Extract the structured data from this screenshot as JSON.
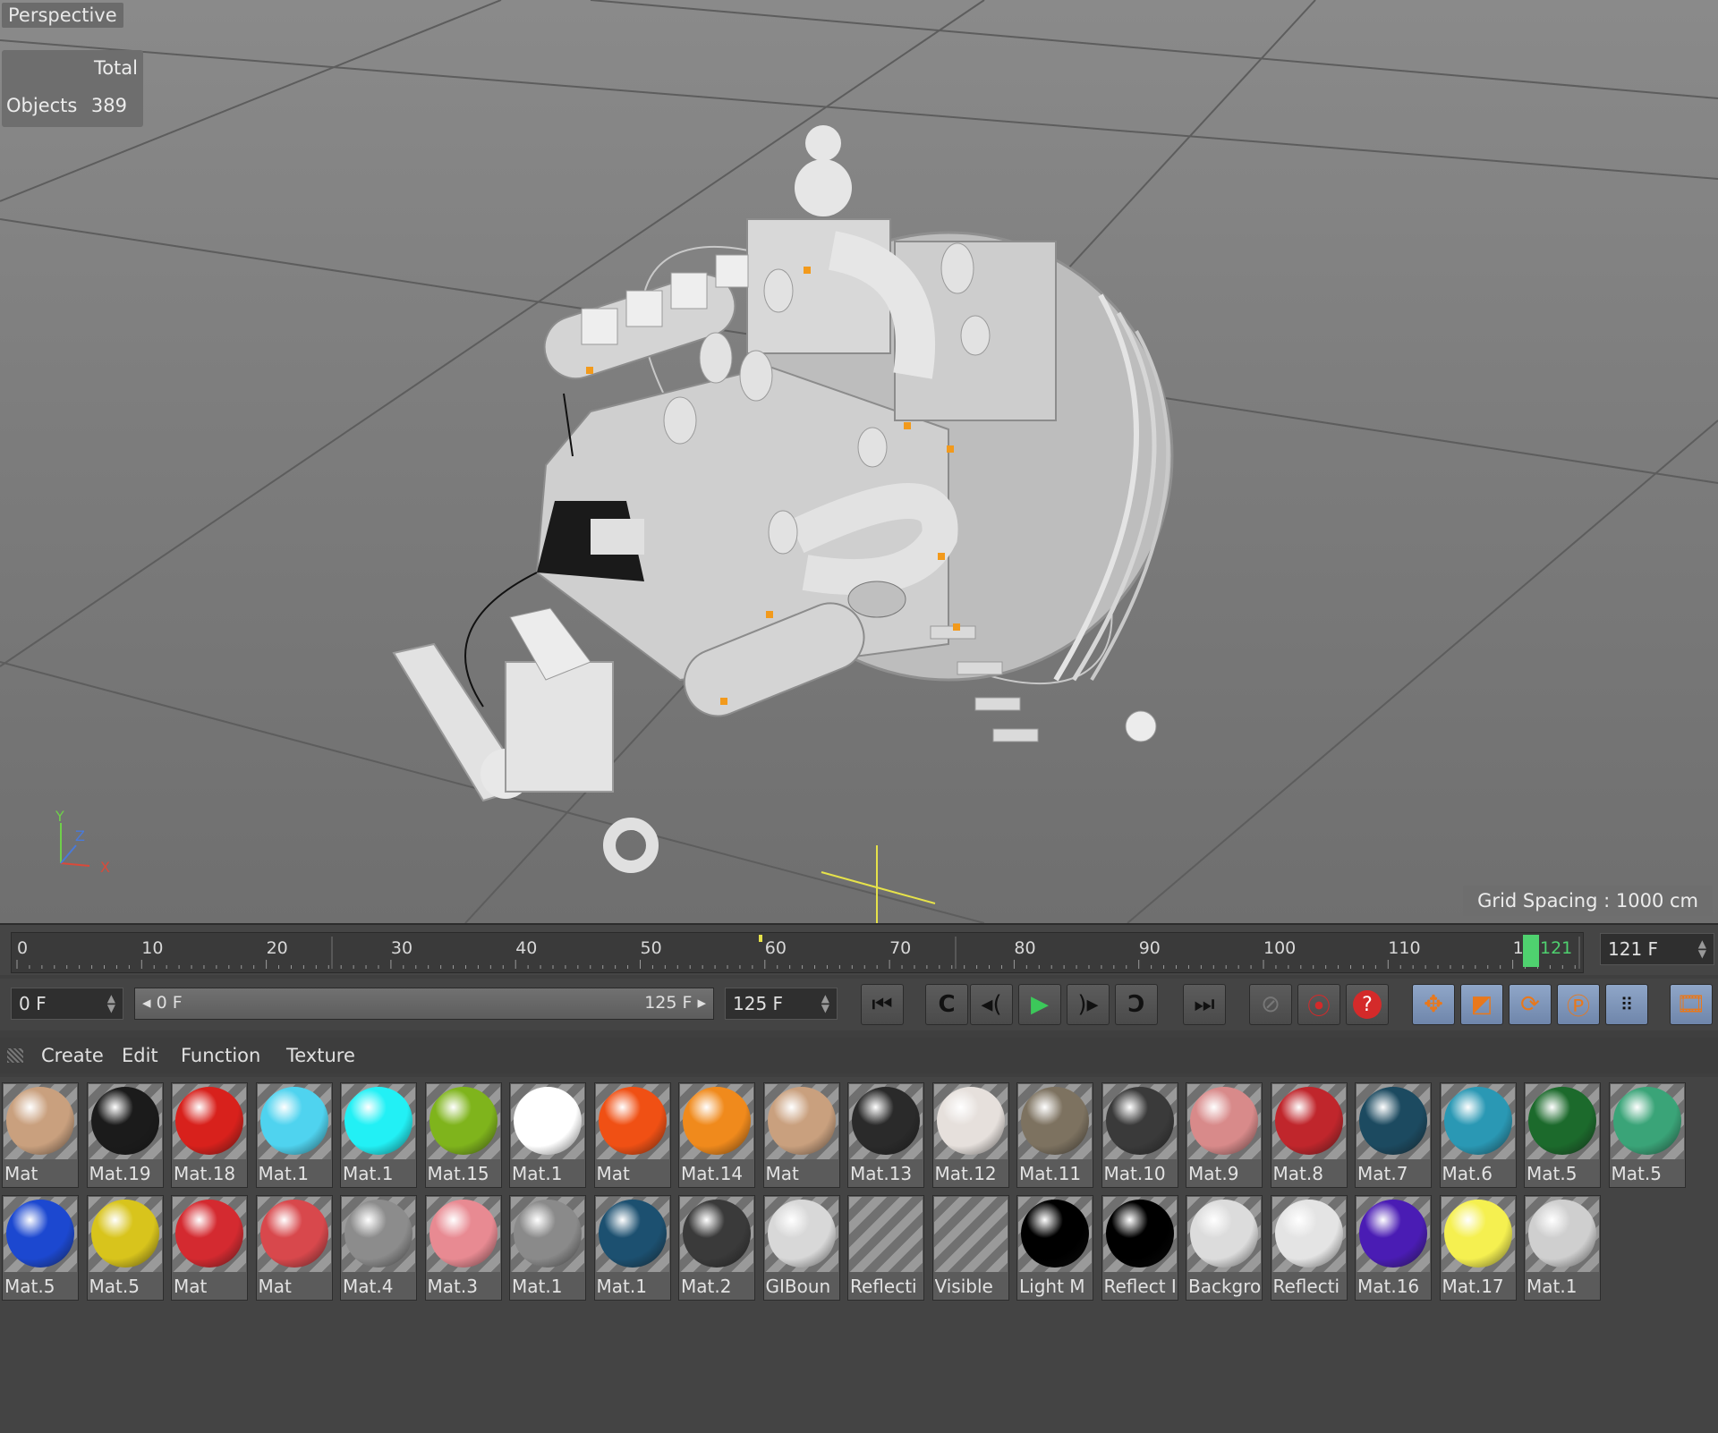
{
  "viewport": {
    "label": "Perspective",
    "stats_header": "Total",
    "stats_label": "Objects",
    "stats_value": "389",
    "grid_spacing": "Grid Spacing : 1000 cm",
    "axis_x": "X",
    "axis_y": "Y",
    "axis_z": "Z"
  },
  "timeline": {
    "ticks": [
      "0",
      "10",
      "20",
      "30",
      "40",
      "50",
      "60",
      "70",
      "80",
      "90",
      "100",
      "110",
      "12"
    ],
    "playhead_label": "121",
    "current_frame": "121 F"
  },
  "transport": {
    "start_field": "0 F",
    "range_start": "0 F",
    "range_end": "125 F",
    "end_field": "125 F"
  },
  "material_menu": [
    "Create",
    "Edit",
    "Function",
    "Texture"
  ],
  "materials_row1": [
    {
      "name": "Mat",
      "color": "#c9a07e"
    },
    {
      "name": "Mat.19",
      "color": "#1b1b1b"
    },
    {
      "name": "Mat.18",
      "color": "#d8211c"
    },
    {
      "name": "Mat.1",
      "color": "#4fd3ef"
    },
    {
      "name": "Mat.1",
      "color": "#22f0f5"
    },
    {
      "name": "Mat.15",
      "color": "#7fb41c"
    },
    {
      "name": "Mat.1",
      "color": "#ffffff"
    },
    {
      "name": "Mat",
      "color": "#f05014"
    },
    {
      "name": "Mat.14",
      "color": "#f08a1c"
    },
    {
      "name": "Mat",
      "color": "#c9a07e"
    },
    {
      "name": "Mat.13",
      "color": "#2a2a2a"
    },
    {
      "name": "Mat.12",
      "color": "#e6e0dc"
    },
    {
      "name": "Mat.11",
      "color": "#7d7260"
    },
    {
      "name": "Mat.10",
      "color": "#3a3a3a"
    },
    {
      "name": "Mat.9",
      "color": "#d88a8a"
    },
    {
      "name": "Mat.8",
      "color": "#c0262c"
    },
    {
      "name": "Mat.7",
      "color": "#1c4a60"
    },
    {
      "name": "Mat.6",
      "color": "#2a98b4"
    },
    {
      "name": "Mat.5",
      "color": "#1c6a2c"
    },
    {
      "name": "Mat.5",
      "color": "#3aa478"
    }
  ],
  "materials_row2": [
    {
      "name": "Mat.5",
      "color": "#1c48d0"
    },
    {
      "name": "Mat.5",
      "color": "#d8c41c"
    },
    {
      "name": "Mat",
      "color": "#d42a30"
    },
    {
      "name": "Mat",
      "color": "#d8484c"
    },
    {
      "name": "Mat.4",
      "color": "#8c8c8c"
    },
    {
      "name": "Mat.3",
      "color": "#e88a92"
    },
    {
      "name": "Mat.1",
      "color": "#8a8a8a"
    },
    {
      "name": "Mat.1",
      "color": "#1c5070"
    },
    {
      "name": "Mat.2",
      "color": "#3a3a3a"
    },
    {
      "name": "GIBoun",
      "color": "#d8d8d8"
    },
    {
      "name": "Reflecti",
      "color": ""
    },
    {
      "name": "Visible",
      "color": ""
    },
    {
      "name": "Light M",
      "color": "#000000"
    },
    {
      "name": "Reflect I",
      "color": "#000000"
    },
    {
      "name": "Backgro",
      "color": "#dcdcdc"
    },
    {
      "name": "Reflecti",
      "color": "#e4e4e4"
    },
    {
      "name": "Mat.16",
      "color": "#4a1cb4"
    },
    {
      "name": "Mat.17",
      "color": "#f5f050"
    },
    {
      "name": "Mat.1",
      "color": "#cfcfcf"
    }
  ]
}
